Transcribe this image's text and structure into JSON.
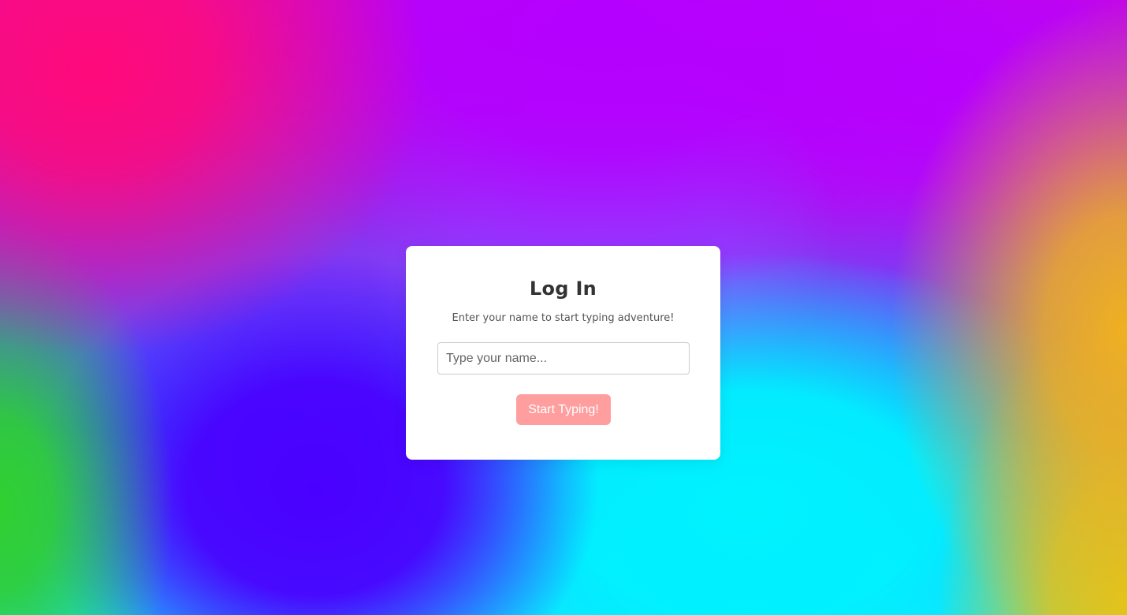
{
  "colors": {
    "card_background": "#ffffff",
    "title_color": "#333333",
    "subtitle_color": "#555555",
    "button_background": "#ff9e9e",
    "button_text": "#ffffff",
    "background_gradient": [
      "#ff0a7a",
      "#b400ff",
      "#4a00ff",
      "#00f2ff",
      "#30d030",
      "#f0b020"
    ]
  },
  "login": {
    "title": "Log In",
    "subtitle": "Enter your name to start typing adventure!",
    "name_input": {
      "value": "",
      "placeholder": "Type your name..."
    },
    "start_button_label": "Start Typing!"
  }
}
